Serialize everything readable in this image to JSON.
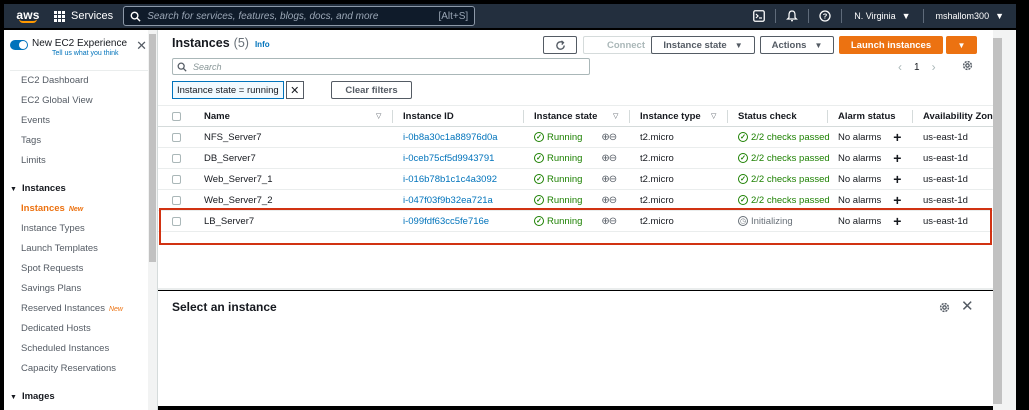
{
  "topnav": {
    "logo_text": "aws",
    "services_label": "Services",
    "search_placeholder": "Search for services, features, blogs, docs, and more",
    "search_shortcut": "[Alt+S]",
    "region": "N. Virginia",
    "account": "mshallom300"
  },
  "sidebar": {
    "new_experience_label": "New EC2 Experience",
    "new_experience_link": "Tell us what you think",
    "top_items": [
      {
        "label": "EC2 Dashboard"
      },
      {
        "label": "EC2 Global View"
      },
      {
        "label": "Events"
      },
      {
        "label": "Tags"
      },
      {
        "label": "Limits"
      }
    ],
    "sections": [
      {
        "label": "Instances",
        "items": [
          {
            "label": "Instances",
            "badge": "New"
          },
          {
            "label": "Instance Types",
            "badge": ""
          },
          {
            "label": "Launch Templates",
            "badge": ""
          },
          {
            "label": "Spot Requests",
            "badge": ""
          },
          {
            "label": "Savings Plans",
            "badge": ""
          },
          {
            "label": "Reserved Instances",
            "badge": "New"
          },
          {
            "label": "Dedicated Hosts",
            "badge": ""
          },
          {
            "label": "Scheduled Instances",
            "badge": ""
          },
          {
            "label": "Capacity Reservations",
            "badge": ""
          }
        ]
      },
      {
        "label": "Images",
        "items": []
      }
    ]
  },
  "main": {
    "title": "Instances",
    "count": "(5)",
    "info": "Info",
    "buttons": {
      "connect": "Connect",
      "instance_state": "Instance state",
      "actions": "Actions",
      "launch": "Launch instances"
    },
    "search_placeholder": "Search",
    "page_number": "1",
    "filter_token": "Instance state = running",
    "clear_filters": "Clear filters"
  },
  "table": {
    "columns": [
      "Name",
      "Instance ID",
      "Instance state",
      "Instance type",
      "Status check",
      "Alarm status",
      "Availability Zone"
    ],
    "rows": [
      {
        "name": "NFS_Server7",
        "id": "i-0b8a30c1a88976d0a",
        "state": "Running",
        "type": "t2.micro",
        "status": "2/2 checks passed",
        "status_ok": true,
        "alarm": "No alarms",
        "az": "us-east-1d"
      },
      {
        "name": "DB_Server7",
        "id": "i-0ceb75cf5d9943791",
        "state": "Running",
        "type": "t2.micro",
        "status": "2/2 checks passed",
        "status_ok": true,
        "alarm": "No alarms",
        "az": "us-east-1d"
      },
      {
        "name": "Web_Server7_1",
        "id": "i-016b78b1c1c4a3092",
        "state": "Running",
        "type": "t2.micro",
        "status": "2/2 checks passed",
        "status_ok": true,
        "alarm": "No alarms",
        "az": "us-east-1d"
      },
      {
        "name": "Web_Server7_2",
        "id": "i-047f03f9b32ea721a",
        "state": "Running",
        "type": "t2.micro",
        "status": "2/2 checks passed",
        "status_ok": true,
        "alarm": "No alarms",
        "az": "us-east-1d"
      },
      {
        "name": "LB_Server7",
        "id": "i-099fdf63cc5fe716e",
        "state": "Running",
        "type": "t2.micro",
        "status": "Initializing",
        "status_ok": false,
        "alarm": "No alarms",
        "az": "us-east-1d"
      }
    ]
  },
  "detail": {
    "title": "Select an instance"
  },
  "colors": {
    "nav_bg": "#232f3e",
    "accent_orange": "#ec7211",
    "link_blue": "#0073bb",
    "success_green": "#1d8102",
    "highlight_red": "#d13212"
  }
}
